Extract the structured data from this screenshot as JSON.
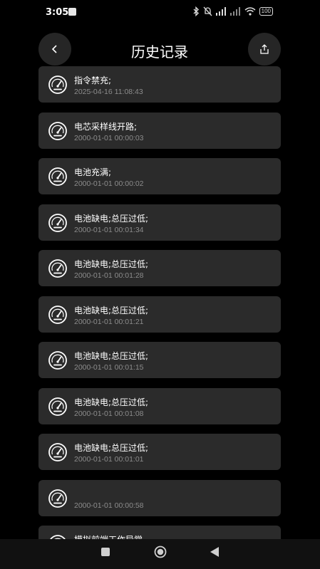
{
  "status_bar": {
    "time": "3:05",
    "battery": "100",
    "icons": [
      "notification-square-icon",
      "bluetooth-icon",
      "mute-icon",
      "signal-icon",
      "signal-icon",
      "wifi-icon",
      "battery-icon"
    ]
  },
  "header": {
    "title": "历史记录",
    "back_icon": "chevron-left-icon",
    "share_icon": "share-icon"
  },
  "records": [
    {
      "title": "指令禁充;",
      "time": "2025-04-16 11:08:43",
      "icon": "gauge-icon"
    },
    {
      "title": "电芯采样线开路;",
      "time": "2000-01-01 00:00:03",
      "icon": "gauge-icon"
    },
    {
      "title": "电池充满;",
      "time": "2000-01-01 00:00:02",
      "icon": "gauge-icon"
    },
    {
      "title": "电池缺电;总压过低;",
      "time": "2000-01-01 00:01:34",
      "icon": "gauge-icon"
    },
    {
      "title": "电池缺电;总压过低;",
      "time": "2000-01-01 00:01:28",
      "icon": "gauge-icon"
    },
    {
      "title": "电池缺电;总压过低;",
      "time": "2000-01-01 00:01:21",
      "icon": "gauge-icon"
    },
    {
      "title": "电池缺电;总压过低;",
      "time": "2000-01-01 00:01:15",
      "icon": "gauge-icon"
    },
    {
      "title": "电池缺电;总压过低;",
      "time": "2000-01-01 00:01:08",
      "icon": "gauge-icon"
    },
    {
      "title": "电池缺电;总压过低;",
      "time": "2000-01-01 00:01:01",
      "icon": "gauge-icon"
    },
    {
      "title": "",
      "time": "2000-01-01 00:00:58",
      "icon": "gauge-icon"
    },
    {
      "title": "模拟前端工作异常",
      "time": "",
      "icon": "gauge-icon"
    }
  ],
  "nav_bar": {
    "icons": [
      "recents-square-icon",
      "home-circle-icon",
      "back-triangle-icon"
    ]
  },
  "colors": {
    "background": "#000000",
    "card": "#2b2b2b",
    "button": "#262626",
    "text": "#ffffff",
    "subtext": "#8c8c8c"
  }
}
